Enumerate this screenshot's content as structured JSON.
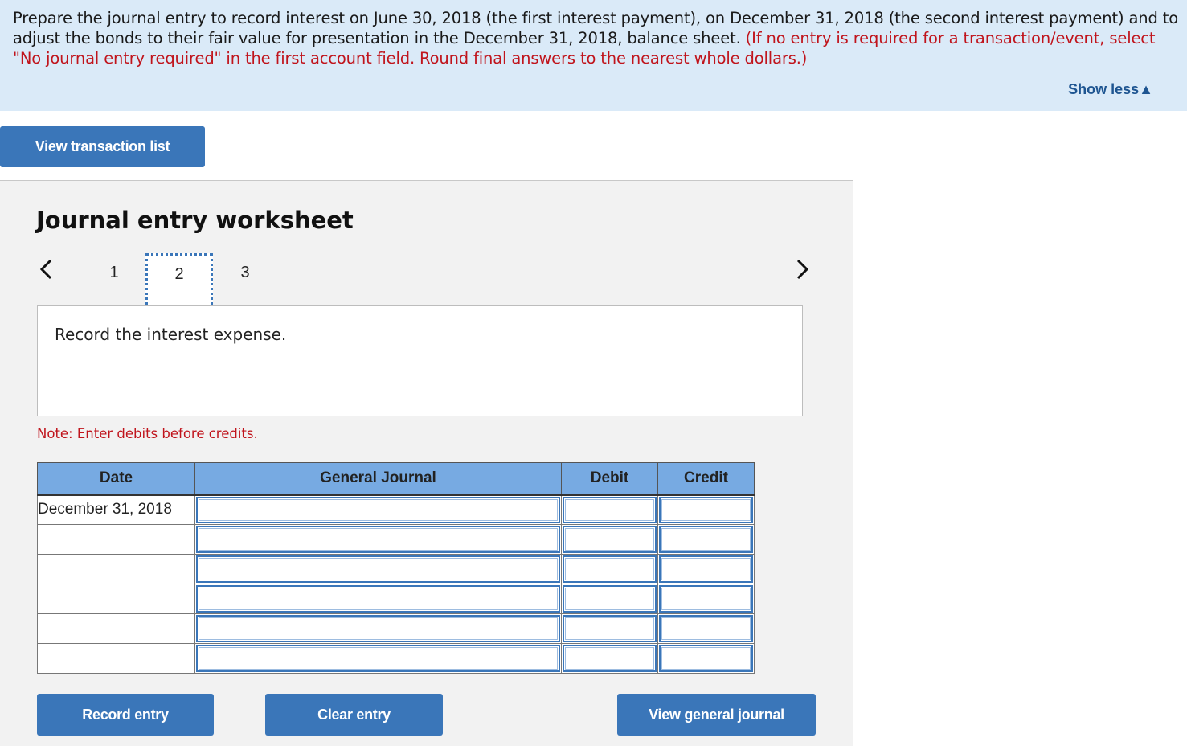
{
  "question": {
    "text_part1": "Prepare the journal entry to record interest on June 30, 2018 (the first interest payment), on December 31, 2018 (the second interest payment) and to adjust the bonds to their fair value for presentation in the December 31, 2018, balance sheet. ",
    "text_instruction": "(If no entry is required for a transaction/event, select \"No journal entry required\" in the first account field. Round final answers to the nearest whole dollars.)",
    "show_less_label": "Show less",
    "show_less_icon": "triangle-up-icon"
  },
  "toolbar": {
    "view_transaction_list_label": "View transaction list"
  },
  "worksheet": {
    "title": "Journal entry worksheet",
    "pages": [
      "1",
      "2",
      "3"
    ],
    "current_page": "2",
    "prev_icon": "chevron-left-icon",
    "next_icon": "chevron-right-icon",
    "instruction": "Record the interest expense.",
    "note": "Note: Enter debits before credits.",
    "table": {
      "headers": [
        "Date",
        "General Journal",
        "Debit",
        "Credit"
      ],
      "rows": [
        {
          "date": "December 31, 2018",
          "account": "",
          "debit": "",
          "credit": ""
        },
        {
          "date": "",
          "account": "",
          "debit": "",
          "credit": ""
        },
        {
          "date": "",
          "account": "",
          "debit": "",
          "credit": ""
        },
        {
          "date": "",
          "account": "",
          "debit": "",
          "credit": ""
        },
        {
          "date": "",
          "account": "",
          "debit": "",
          "credit": ""
        },
        {
          "date": "",
          "account": "",
          "debit": "",
          "credit": ""
        }
      ]
    },
    "buttons": {
      "record_entry": "Record entry",
      "clear_entry": "Clear entry",
      "view_general_journal": "View general journal"
    }
  },
  "colors": {
    "accent": "#3a76b9",
    "header_blue": "#77aae2",
    "question_bg": "#daeaf8",
    "error_red": "#c0141c",
    "link_blue": "#1e5591"
  }
}
